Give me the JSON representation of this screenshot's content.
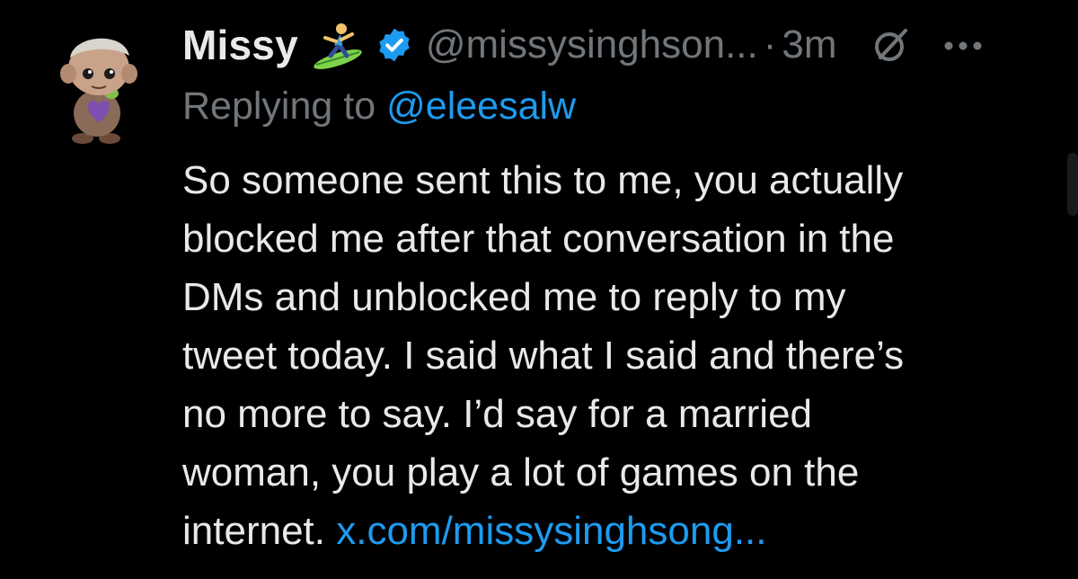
{
  "tweet": {
    "display_name": "Missy",
    "handle": "@missysinghson...",
    "separator": "·",
    "time": "3m",
    "replying_prefix": "Replying to",
    "replying_handle": "@eleesalw",
    "body_lines": [
      "So someone sent this to me, you actually",
      "blocked me after that conversation in the",
      "DMs and unblocked me to reply to my",
      "tweet today. I said what I said and there’s",
      "no more to say. I’d say for a married",
      "woman, you play a lot of games on the"
    ],
    "last_line_text": "internet.",
    "link_text": "x.com/missysinghsong..."
  },
  "icons": {
    "avatar": "avatar-figurine",
    "name_emoji": "person-surfing-emoji",
    "verified": "verified-badge-icon",
    "grok": "grok-icon",
    "more": "more-options-icon"
  },
  "colors": {
    "background": "#000000",
    "text": "#e7e9ea",
    "muted": "#71767b",
    "accent": "#1d9bf0"
  }
}
